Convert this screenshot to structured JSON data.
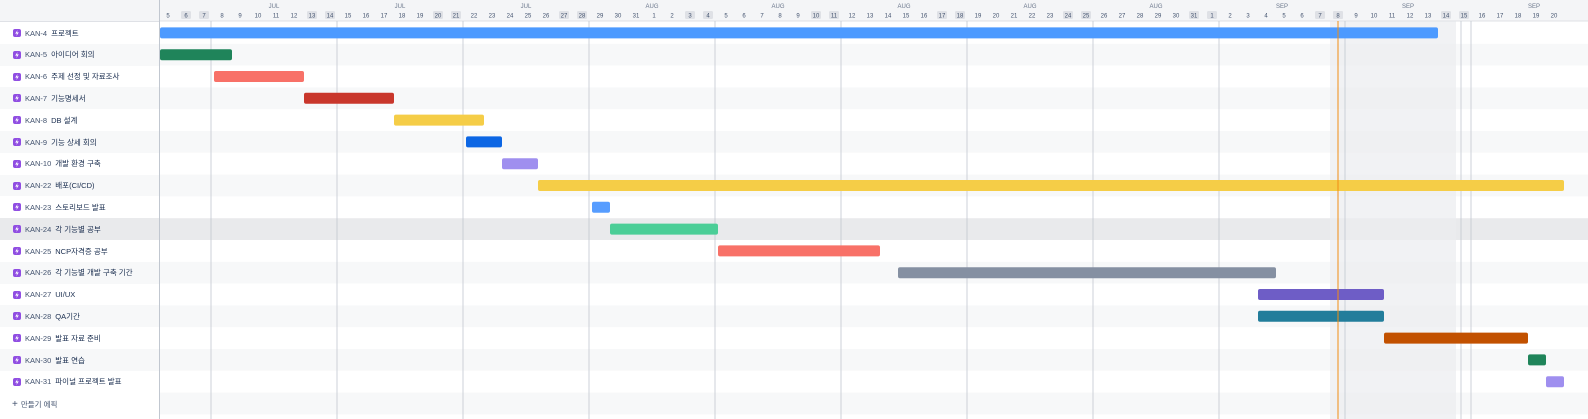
{
  "months": [
    {
      "label": "JUL",
      "pos": 0
    },
    {
      "label": "JUL",
      "pos": 1
    },
    {
      "label": "JUL",
      "pos": 2
    },
    {
      "label": "AUG",
      "pos": 3
    },
    {
      "label": "AUG",
      "pos": 4
    },
    {
      "label": "AUG",
      "pos": 5
    },
    {
      "label": "AUG",
      "pos": 6
    },
    {
      "label": "AUG",
      "pos": 7
    },
    {
      "label": "SEP",
      "pos": 8
    },
    {
      "label": "SEP",
      "pos": 9
    },
    {
      "label": "SEP",
      "pos": 10
    }
  ],
  "days": [
    "5",
    "6",
    "7",
    "8",
    "9",
    "10",
    "11",
    "12",
    "13",
    "14",
    "15",
    "16",
    "17",
    "18",
    "19",
    "20",
    "21",
    "22",
    "23",
    "24",
    "25",
    "26",
    "27",
    "28",
    "29",
    "30",
    "31",
    "1",
    "2",
    "3",
    "4",
    "5",
    "6",
    "7",
    "8",
    "9",
    "10",
    "11",
    "12",
    "13",
    "14",
    "15",
    "16",
    "17",
    "18",
    "19",
    "20",
    "21",
    "22",
    "23",
    "24",
    "25",
    "26",
    "27",
    "28",
    "29",
    "30",
    "31",
    "1",
    "2",
    "3",
    "4",
    "5",
    "6",
    "7",
    "8",
    "9",
    "10",
    "11",
    "12",
    "13",
    "14",
    "15",
    "16",
    "17",
    "18",
    "19",
    "20"
  ],
  "weekend_days": [
    1,
    2,
    8,
    9,
    15,
    16,
    22,
    23,
    29,
    30,
    36,
    37,
    43,
    44,
    50,
    51,
    57,
    58,
    64,
    65,
    71,
    72
  ],
  "today_index": 65,
  "highlight_week": [
    65,
    72
  ],
  "issues": [
    {
      "key": "KAN-4",
      "summary": "프로젝트",
      "start": 0,
      "end": 71,
      "color": "#4c9aff"
    },
    {
      "key": "KAN-5",
      "summary": "아이디어 회의",
      "start": 0,
      "end": 4,
      "color": "#1f845a"
    },
    {
      "key": "KAN-6",
      "summary": "주제 선정 및 자료조사",
      "start": 3,
      "end": 8,
      "color": "#f87168"
    },
    {
      "key": "KAN-7",
      "summary": "기능명세서",
      "start": 8,
      "end": 13,
      "color": "#c9372c"
    },
    {
      "key": "KAN-8",
      "summary": "DB 설계",
      "start": 13,
      "end": 18,
      "color": "#f5cd47"
    },
    {
      "key": "KAN-9",
      "summary": "기능 상세 회의",
      "start": 17,
      "end": 19,
      "color": "#0c66e4"
    },
    {
      "key": "KAN-10",
      "summary": "개발 환경 구축",
      "start": 19,
      "end": 21,
      "color": "#9f8fef"
    },
    {
      "key": "KAN-22",
      "summary": "배포(CI/CD)",
      "start": 21,
      "end": 78,
      "color": "#f5cd47"
    },
    {
      "key": "KAN-23",
      "summary": "스토리보드 발표",
      "start": 24,
      "end": 25,
      "color": "#579dff"
    },
    {
      "key": "KAN-24",
      "summary": "각 기능별 공부",
      "start": 25,
      "end": 31,
      "color": "#4bce97"
    },
    {
      "key": "KAN-25",
      "summary": "NCP자격증 공부",
      "start": 31,
      "end": 40,
      "color": "#f87168"
    },
    {
      "key": "KAN-26",
      "summary": "각 기능별 개발 구축 기간",
      "start": 41,
      "end": 62,
      "color": "#8590a2"
    },
    {
      "key": "KAN-27",
      "summary": "UI/UX",
      "start": 61,
      "end": 68,
      "color": "#6e5dc6"
    },
    {
      "key": "KAN-28",
      "summary": "QA기간",
      "start": 61,
      "end": 68,
      "color": "#227d9b"
    },
    {
      "key": "KAN-29",
      "summary": "발표 자료 준비",
      "start": 68,
      "end": 76,
      "color": "#c25100"
    },
    {
      "key": "KAN-30",
      "summary": "발표 연습",
      "start": 76,
      "end": 77,
      "color": "#1f845a"
    },
    {
      "key": "KAN-31",
      "summary": "파이널 프로젝트 발표",
      "start": 77,
      "end": 78,
      "color": "#9f8fef"
    }
  ],
  "highlighted_row": 9,
  "create_label": "만들기 에픽",
  "colors": {
    "today": "#f18d13",
    "weekend_bg": "#dfe1e6",
    "grid": "#dfe1e6",
    "week_shade": "#ebecf0"
  }
}
